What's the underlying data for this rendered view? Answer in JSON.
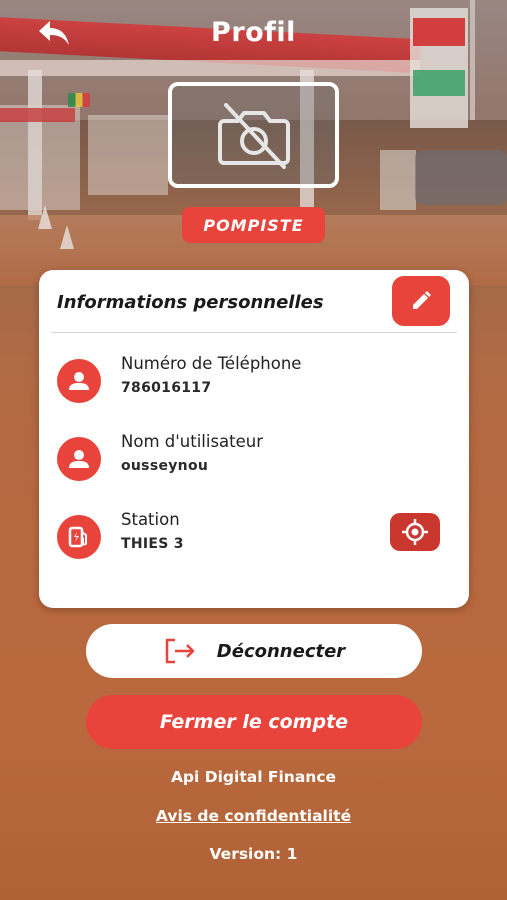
{
  "header": {
    "title": "Profil"
  },
  "profile": {
    "role": "POMPISTE"
  },
  "personal_info": {
    "title": "Informations personnelles",
    "fields": [
      {
        "label": "Numéro de Téléphone",
        "value": "786016117",
        "icon": "user-icon"
      },
      {
        "label": "Nom d'utilisateur",
        "value": "ousseynou",
        "icon": "user-icon"
      },
      {
        "label": "Station",
        "value": "THIES 3",
        "icon": "fuel-pump-icon"
      }
    ]
  },
  "actions": {
    "logout_label": "Déconnecter",
    "close_account_label": "Fermer le compte"
  },
  "footer": {
    "company": "Api Digital Finance",
    "privacy": "Avis de confidentialité",
    "version": "Version: 1"
  },
  "colors": {
    "accent": "#e8443c",
    "accent_dark": "#c9372f",
    "card": "#ffffff",
    "text": "#1a1a1a"
  }
}
